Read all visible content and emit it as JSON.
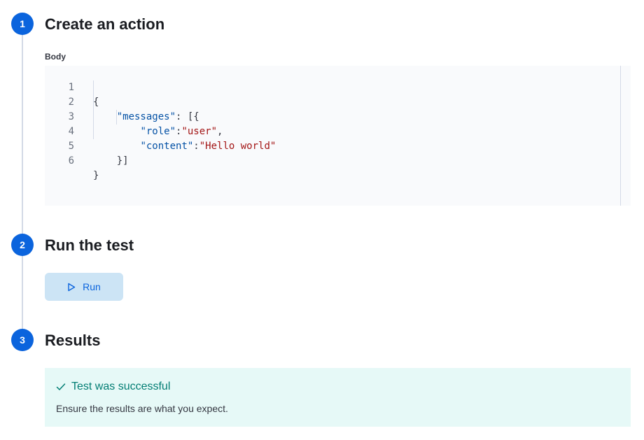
{
  "steps": [
    {
      "number": "1",
      "title": "Create an action"
    },
    {
      "number": "2",
      "title": "Run the test"
    },
    {
      "number": "3",
      "title": "Results"
    }
  ],
  "body_label": "Body",
  "editor": {
    "line_numbers": [
      "1",
      "2",
      "3",
      "4",
      "5",
      "6"
    ]
  },
  "run_button": {
    "label": "Run",
    "icon": "play-icon"
  },
  "result": {
    "title": "Test was successful",
    "message": "Ensure the results are what you expect.",
    "icon": "check-icon"
  },
  "colors": {
    "step_badge": "#0b64dd",
    "run_button_bg": "#cce4f5",
    "success_bg": "#e6f9f7",
    "success_text": "#017d73"
  }
}
